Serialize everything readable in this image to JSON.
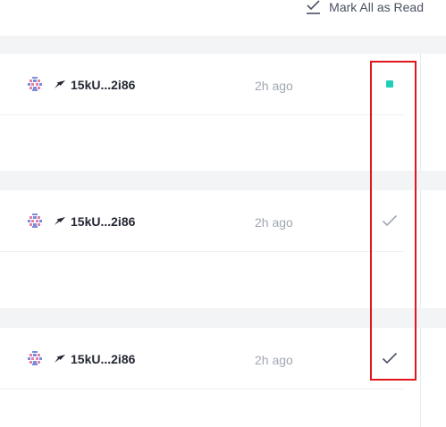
{
  "header": {
    "mark_all_label": "Mark All as Read",
    "mark_all_icon": "check-underline-icon"
  },
  "notifications": [
    {
      "address": "15kU...2i86",
      "time": "2h ago",
      "status": "unread",
      "status_icon": "unread-dot-icon",
      "status_color": "#1ecfb7"
    },
    {
      "address": "15kU...2i86",
      "time": "2h ago",
      "status": "read",
      "status_icon": "check-icon",
      "status_color": "#a1a7b3"
    },
    {
      "address": "15kU...2i86",
      "time": "2h ago",
      "status": "read",
      "status_icon": "check-icon",
      "status_color": "#4a5262"
    }
  ],
  "colors": {
    "highlight": "#e0161a",
    "accent": "#1ecfb7"
  }
}
